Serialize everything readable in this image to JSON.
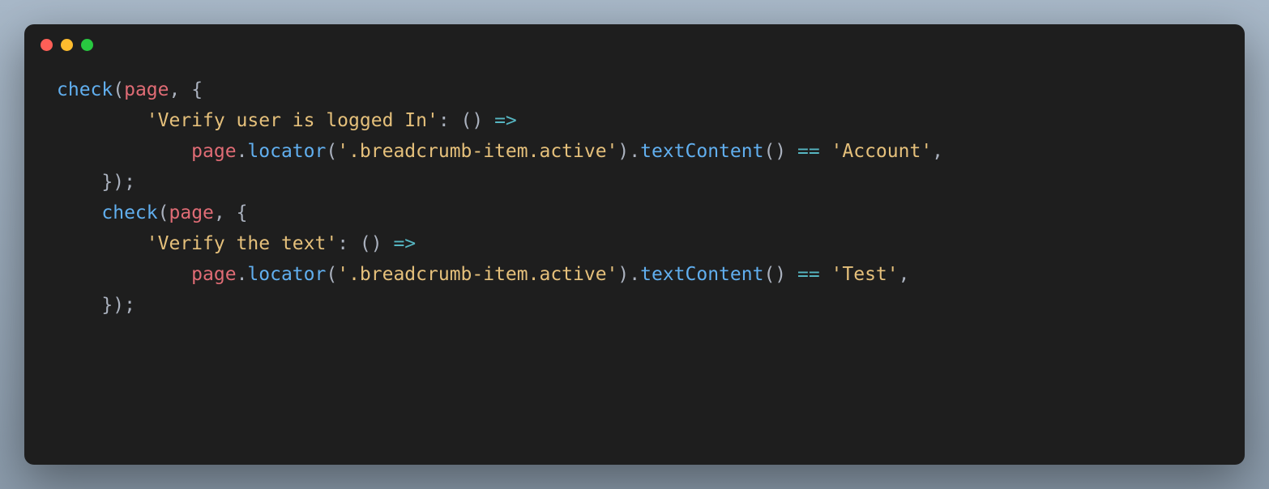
{
  "titlebar": {
    "close": "close",
    "minimize": "minimize",
    "maximize": "maximize"
  },
  "code": {
    "line1": {
      "fn": "check",
      "p1": "(",
      "arg": "page",
      "comma": ", {"
    },
    "line2": {
      "indent": "        ",
      "str": "'Verify user is logged In'",
      "colon": ": () ",
      "arrow": "=>"
    },
    "line3": {
      "indent": "            ",
      "obj": "page",
      "dot1": ".",
      "m1": "locator",
      "p1": "(",
      "str": "'.breadcrumb-item.active'",
      "p2": ").",
      "m2": "textContent",
      "p3": "() ",
      "eq": "==",
      "sp": " ",
      "str2": "'Account'",
      "end": ","
    },
    "line4": {
      "indent": "    ",
      "close": "});"
    },
    "line5": {
      "indent": "    ",
      "fn": "check",
      "p1": "(",
      "arg": "page",
      "comma": ", {"
    },
    "line6": {
      "indent": "        ",
      "str": "'Verify the text'",
      "colon": ": () ",
      "arrow": "=>"
    },
    "line7": {
      "indent": "            ",
      "obj": "page",
      "dot1": ".",
      "m1": "locator",
      "p1": "(",
      "str": "'.breadcrumb-item.active'",
      "p2": ").",
      "m2": "textContent",
      "p3": "() ",
      "eq": "==",
      "sp": " ",
      "str2": "'Test'",
      "end": ","
    },
    "line8": {
      "indent": "    ",
      "close": "});"
    }
  }
}
